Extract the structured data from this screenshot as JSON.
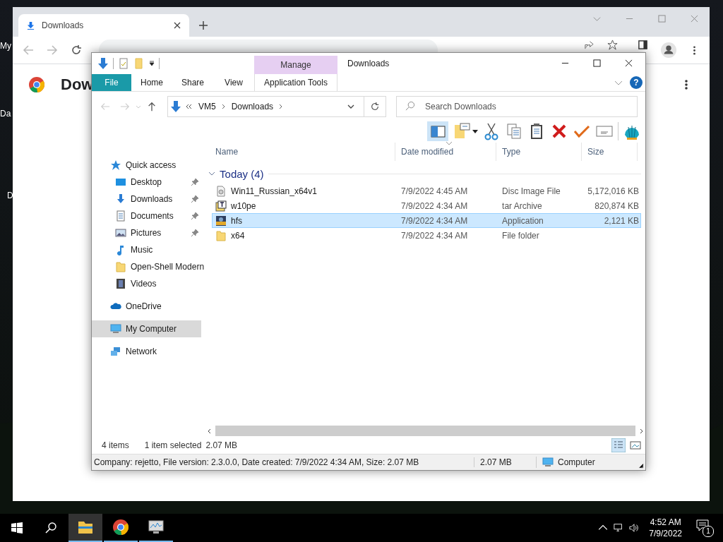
{
  "desktop": {
    "icons": [
      {
        "label": "My"
      },
      {
        "label": "Da"
      },
      {
        "label": "D"
      }
    ]
  },
  "chrome": {
    "tab": {
      "title": "Downloads",
      "selected": true
    },
    "page_title": "Dow"
  },
  "explorer": {
    "title": "Downloads",
    "context_group": "Manage",
    "ribbon_tabs": [
      {
        "label": "File",
        "kind": "file"
      },
      {
        "label": "Home",
        "kind": "plain"
      },
      {
        "label": "Share",
        "kind": "plain"
      },
      {
        "label": "View",
        "kind": "plain"
      },
      {
        "label": "Application Tools",
        "kind": "context"
      }
    ],
    "address": {
      "path": [
        "VM5",
        "Downloads"
      ]
    },
    "search": {
      "placeholder": "Search Downloads"
    },
    "help_label": "?",
    "sidebar": [
      {
        "label": "Quick access",
        "kind": "star",
        "selected": false,
        "children": [
          {
            "label": "Desktop",
            "kind": "desktop",
            "pinned": true,
            "selected": false
          },
          {
            "label": "Downloads",
            "kind": "download",
            "pinned": true,
            "selected": false
          },
          {
            "label": "Documents",
            "kind": "document",
            "pinned": true,
            "selected": false
          },
          {
            "label": "Pictures",
            "kind": "pictures",
            "pinned": true,
            "selected": false
          },
          {
            "label": "Music",
            "kind": "music",
            "pinned": false,
            "selected": false
          },
          {
            "label": "Open-Shell Modern",
            "kind": "folder",
            "pinned": false,
            "selected": false
          },
          {
            "label": "Videos",
            "kind": "videos",
            "pinned": false,
            "selected": false
          }
        ]
      },
      {
        "label": "OneDrive",
        "kind": "cloud",
        "selected": false
      },
      {
        "label": "My Computer",
        "kind": "computer",
        "selected": true
      },
      {
        "label": "Network",
        "kind": "network",
        "selected": false
      }
    ],
    "columns": [
      "Name",
      "Date modified",
      "Type",
      "Size"
    ],
    "groups": [
      {
        "label": "Today (4)",
        "expanded": true,
        "rows": [
          {
            "name": "Win11_Russian_x64v1",
            "date": "7/9/2022 4:45 AM",
            "type": "Disc Image File",
            "size": "5,172,016 KB",
            "kind": "disc",
            "selected": false
          },
          {
            "name": "w10pe",
            "date": "7/9/2022 4:34 AM",
            "type": "tar Archive",
            "size": "820,874 KB",
            "kind": "archive",
            "selected": false
          },
          {
            "name": "hfs",
            "date": "7/9/2022 4:34 AM",
            "type": "Application",
            "size": "2,121 KB",
            "kind": "application",
            "selected": true
          },
          {
            "name": "x64",
            "date": "7/9/2022 4:34 AM",
            "type": "File folder",
            "size": "",
            "kind": "folder",
            "selected": false
          }
        ]
      }
    ],
    "status": {
      "count": "4 items",
      "selection": "1 item selected",
      "size": "2.07 MB"
    },
    "details_bar": {
      "info": "Company: rejetto, File version: 2.3.0.0, Date created: 7/9/2022 4:34 AM, Size: 2.07 MB",
      "size": "2.07 MB",
      "location": "Computer"
    }
  },
  "taskbar": {
    "apps": [
      {
        "kind": "explorer",
        "selected": true
      },
      {
        "kind": "chrome",
        "selected": false
      },
      {
        "kind": "monitor",
        "selected": false
      }
    ],
    "time": "4:52 AM",
    "date": "7/9/2022",
    "notifications": "1"
  }
}
